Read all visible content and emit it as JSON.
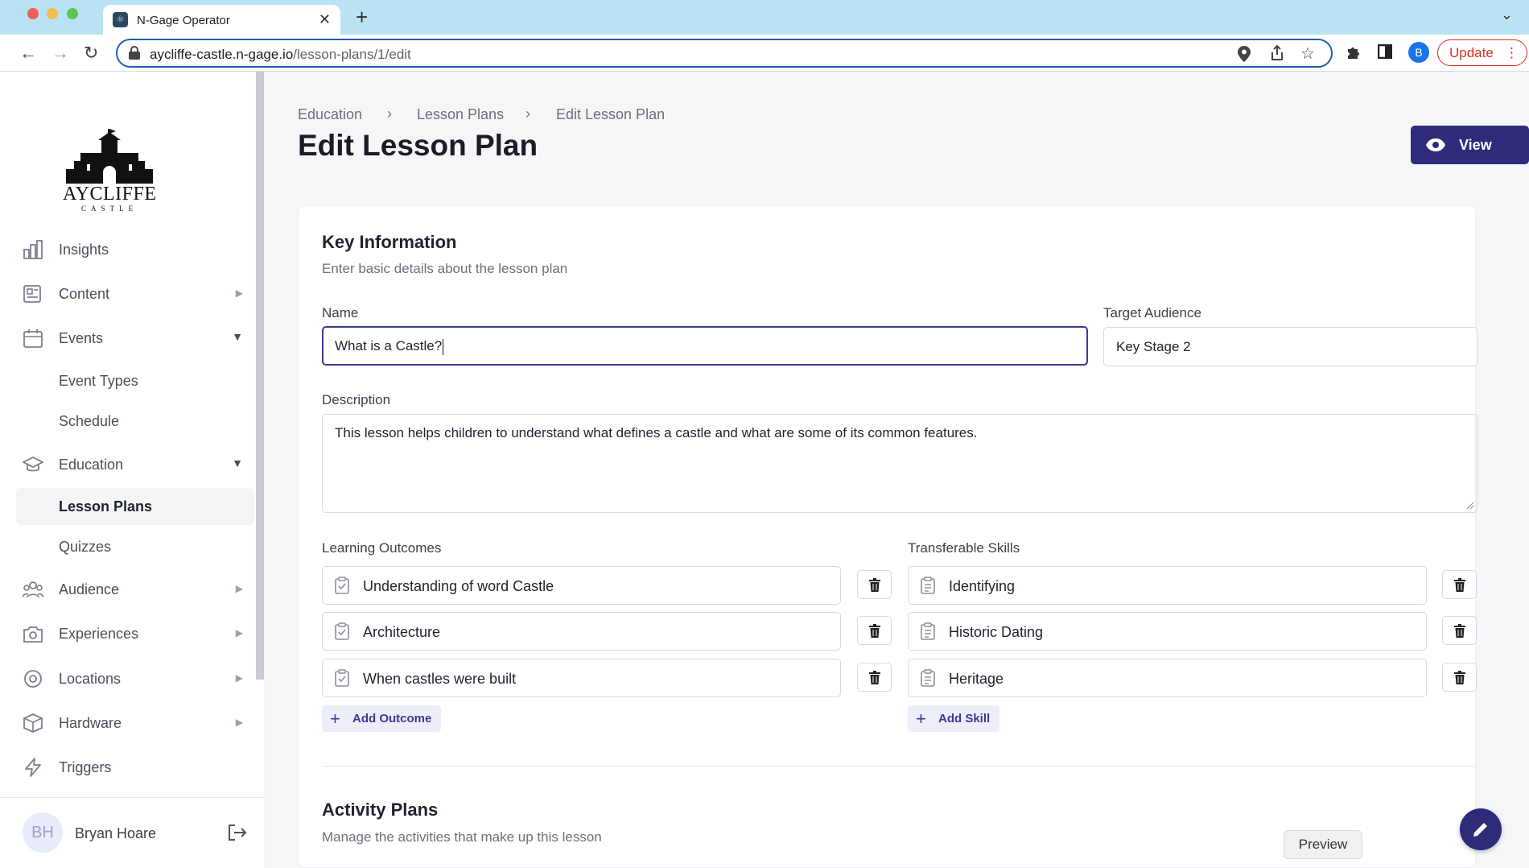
{
  "browser": {
    "tab_title": "N-Gage Operator",
    "url_host": "aycliffe-castle.n-gage.io",
    "url_path": "/lesson-plans/1/edit",
    "profile_initial": "B",
    "update_label": "Update"
  },
  "sidebar": {
    "logo_text": "AYCLIFFE",
    "logo_subtext": "CASTLE",
    "items": [
      {
        "label": "Insights",
        "icon": "bar-chart-icon"
      },
      {
        "label": "Content",
        "icon": "newspaper-icon"
      },
      {
        "label": "Events",
        "icon": "calendar-icon"
      },
      {
        "label": "Event Types"
      },
      {
        "label": "Schedule"
      },
      {
        "label": "Education",
        "icon": "graduation-cap-icon"
      },
      {
        "label": "Lesson Plans"
      },
      {
        "label": "Quizzes"
      },
      {
        "label": "Audience",
        "icon": "users-icon"
      },
      {
        "label": "Experiences",
        "icon": "camera-icon"
      },
      {
        "label": "Locations",
        "icon": "map-pin-icon"
      },
      {
        "label": "Hardware",
        "icon": "cube-icon"
      },
      {
        "label": "Triggers",
        "icon": "lightning-icon"
      }
    ],
    "user": {
      "initials": "BH",
      "name": "Bryan Hoare"
    }
  },
  "header": {
    "breadcrumb": [
      "Education",
      "Lesson Plans",
      "Edit Lesson Plan"
    ],
    "title": "Edit Lesson Plan",
    "view_label": "View"
  },
  "key_info": {
    "title": "Key Information",
    "subtitle": "Enter basic details about the lesson plan",
    "name_label": "Name",
    "name_value": "What is a Castle?",
    "audience_label": "Target Audience",
    "audience_value": "Key Stage 2",
    "description_label": "Description",
    "description_value": "This lesson helps children to understand what defines a castle and what are some of its common features.",
    "outcomes_label": "Learning Outcomes",
    "outcomes": [
      "Understanding of word Castle",
      "Architecture",
      "When castles were built"
    ],
    "add_outcome_label": "Add Outcome",
    "skills_label": "Transferable Skills",
    "skills": [
      "Identifying",
      "Historic Dating",
      "Heritage"
    ],
    "add_skill_label": "Add Skill"
  },
  "activity": {
    "title": "Activity Plans",
    "subtitle": "Manage the activities that make up this lesson"
  },
  "tooltip": {
    "label": "Preview"
  },
  "colors": {
    "primary": "#2d2b7a",
    "accent_bg": "#eceefa"
  }
}
